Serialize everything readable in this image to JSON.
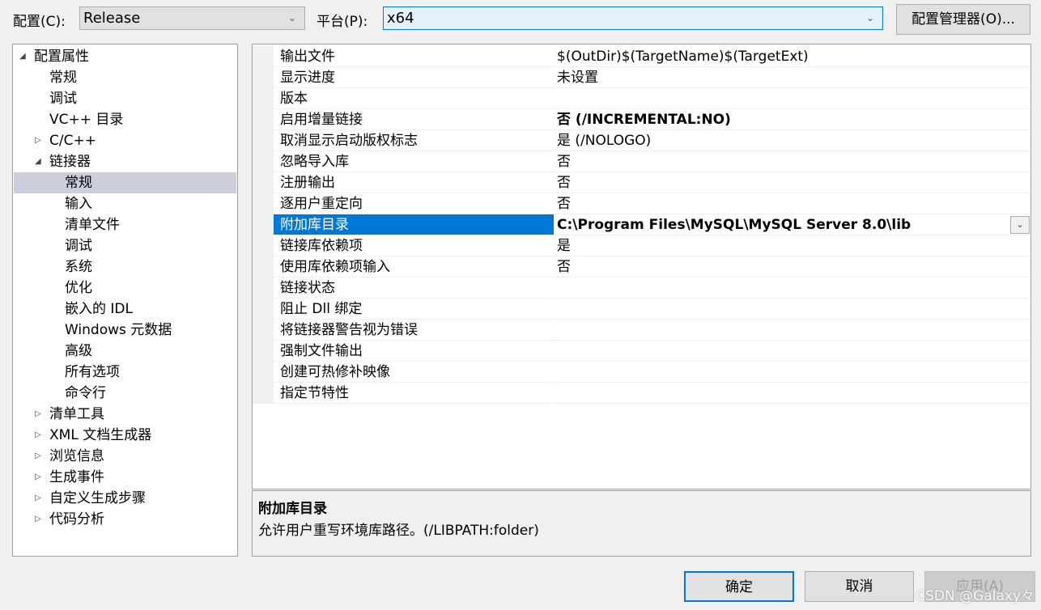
{
  "toolbar": {
    "config_label": "配置(C):",
    "config_value": "Release",
    "platform_label": "平台(P):",
    "platform_value": "x64",
    "config_manager": "配置管理器(O)..."
  },
  "tree": [
    {
      "label": "配置属性",
      "level": 0,
      "expander": "expanded"
    },
    {
      "label": "常规",
      "level": 1
    },
    {
      "label": "调试",
      "level": 1
    },
    {
      "label": "VC++ 目录",
      "level": 1
    },
    {
      "label": "C/C++",
      "level": 1,
      "expander": "collapsed"
    },
    {
      "label": "链接器",
      "level": 1,
      "expander": "expanded"
    },
    {
      "label": "常规",
      "level": 2,
      "selected": true
    },
    {
      "label": "输入",
      "level": 2
    },
    {
      "label": "清单文件",
      "level": 2
    },
    {
      "label": "调试",
      "level": 2
    },
    {
      "label": "系统",
      "level": 2
    },
    {
      "label": "优化",
      "level": 2
    },
    {
      "label": "嵌入的 IDL",
      "level": 2
    },
    {
      "label": "Windows 元数据",
      "level": 2
    },
    {
      "label": "高级",
      "level": 2
    },
    {
      "label": "所有选项",
      "level": 2
    },
    {
      "label": "命令行",
      "level": 2
    },
    {
      "label": "清单工具",
      "level": 1,
      "expander": "collapsed"
    },
    {
      "label": "XML 文档生成器",
      "level": 1,
      "expander": "collapsed"
    },
    {
      "label": "浏览信息",
      "level": 1,
      "expander": "collapsed"
    },
    {
      "label": "生成事件",
      "level": 1,
      "expander": "collapsed"
    },
    {
      "label": "自定义生成步骤",
      "level": 1,
      "expander": "collapsed"
    },
    {
      "label": "代码分析",
      "level": 1,
      "expander": "collapsed"
    }
  ],
  "properties": [
    {
      "name": "输出文件",
      "value": "$(OutDir)$(TargetName)$(TargetExt)"
    },
    {
      "name": "显示进度",
      "value": "未设置"
    },
    {
      "name": "版本",
      "value": ""
    },
    {
      "name": "启用增量链接",
      "value": "否 (/INCREMENTAL:NO)",
      "bold": true
    },
    {
      "name": "取消显示启动版权标志",
      "value": "是 (/NOLOGO)"
    },
    {
      "name": "忽略导入库",
      "value": "否"
    },
    {
      "name": "注册输出",
      "value": "否"
    },
    {
      "name": "逐用户重定向",
      "value": "否"
    },
    {
      "name": "附加库目录",
      "value": "C:\\Program Files\\MySQL\\MySQL Server 8.0\\lib",
      "bold": true,
      "selected": true
    },
    {
      "name": "链接库依赖项",
      "value": "是"
    },
    {
      "name": "使用库依赖项输入",
      "value": "否"
    },
    {
      "name": "链接状态",
      "value": ""
    },
    {
      "name": "阻止 Dll 绑定",
      "value": ""
    },
    {
      "name": "将链接器警告视为错误",
      "value": ""
    },
    {
      "name": "强制文件输出",
      "value": ""
    },
    {
      "name": "创建可热修补映像",
      "value": ""
    },
    {
      "name": "指定节特性",
      "value": ""
    }
  ],
  "description": {
    "title": "附加库目录",
    "text": "允许用户重写环境库路径。(/LIBPATH:folder)"
  },
  "buttons": {
    "ok": "确定",
    "cancel": "取消",
    "apply": "应用(A)"
  },
  "watermark": "CSDN @Galaxy々",
  "colors": {
    "selection": "#0078d7",
    "tree_selection": "#cccedb",
    "focus_border": "#0078d7"
  }
}
